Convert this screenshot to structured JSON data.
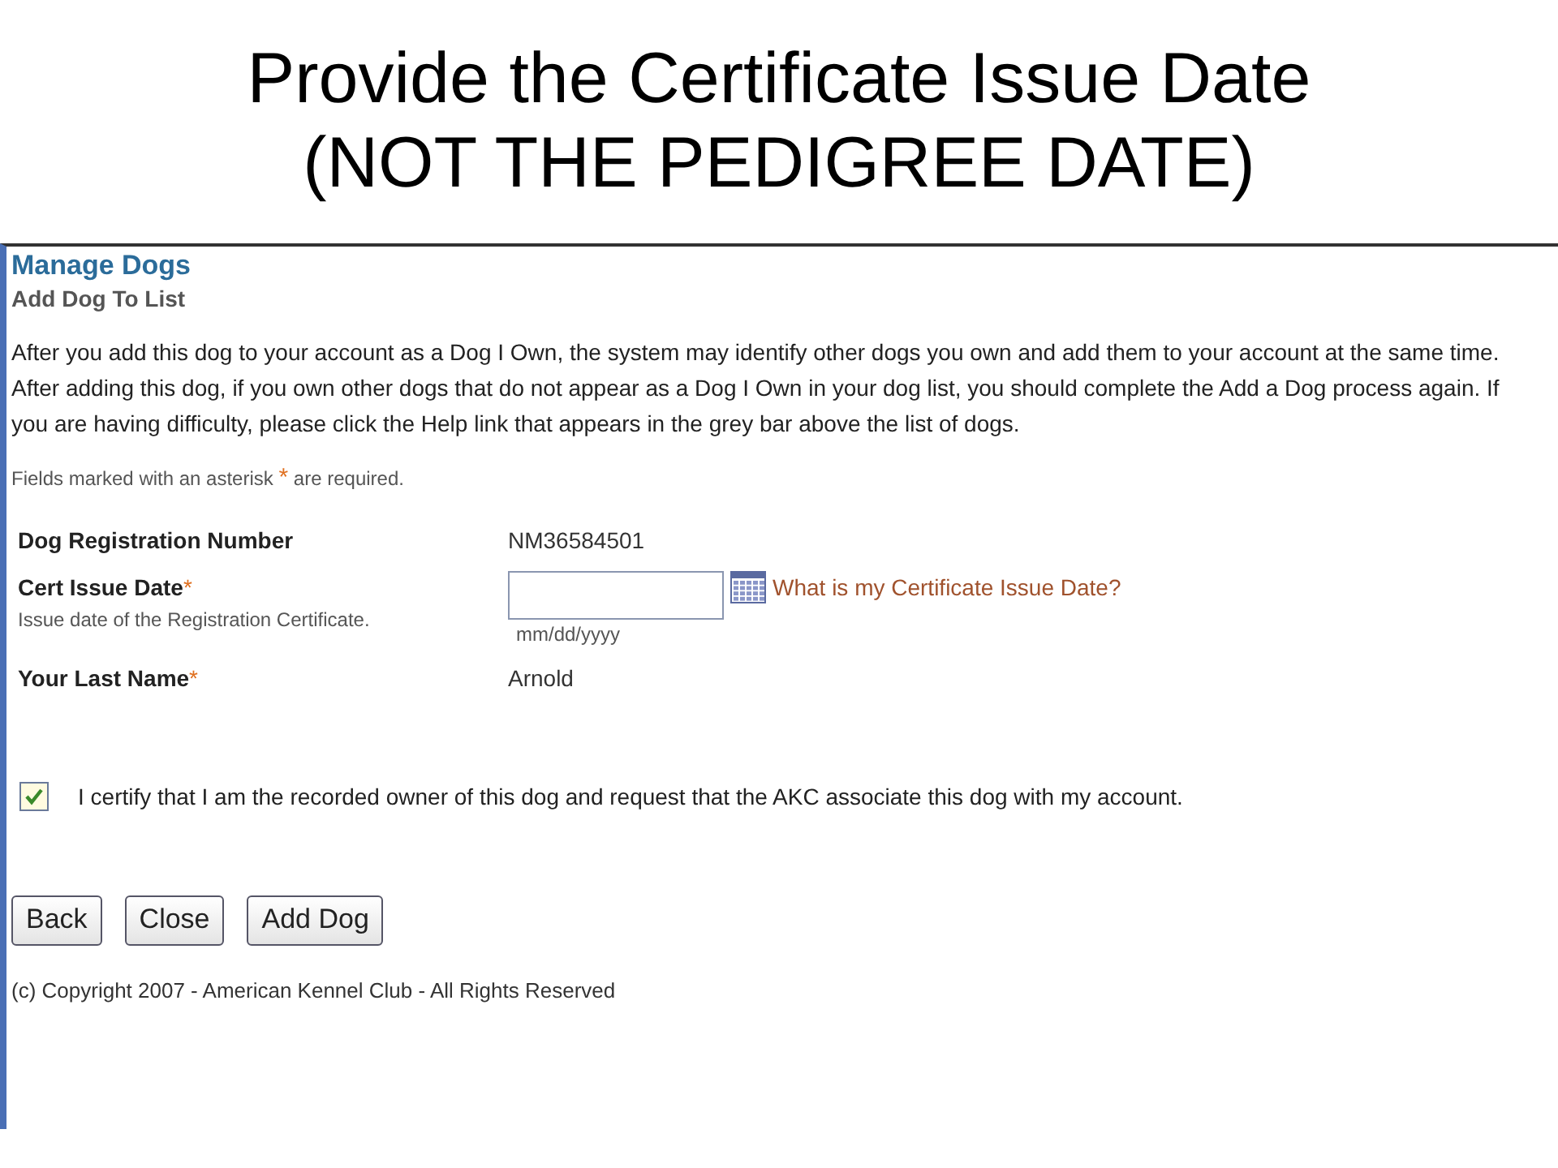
{
  "slide_title": [
    "Provide the Certificate Issue Date",
    "(NOT THE PEDIGREE DATE)"
  ],
  "page": {
    "title": "Manage Dogs",
    "subtitle": "Add Dog To List",
    "intro": "After you add this dog to your account as a Dog I Own, the system may identify other dogs you own and add them to your account at the same time. After adding this dog, if you own other dogs that do not appear as a Dog I Own in your dog list, you should complete the Add a Dog process again. If you are having difficulty, please click the Help link that appears in the grey bar above the list of dogs.",
    "required_note": {
      "before": "Fields marked with an asterisk",
      "mark": "*",
      "after": "are required."
    },
    "fields": [
      {
        "kind": "text",
        "label": "Dog Registration Number",
        "value": "NM36584501"
      },
      {
        "kind": "date",
        "label": "Cert Issue Date",
        "mark": "*",
        "hint": "Issue date of the Registration Certificate.",
        "format": "mm/dd/yyyy",
        "link": "What is my Certificate Issue Date?"
      },
      {
        "kind": "text",
        "label": "Your Last Name",
        "mark": "*",
        "value": "Arnold"
      }
    ],
    "certify": {
      "checked": true,
      "label": "I certify that I am the recorded owner of this dog and request that the AKC associate this dog with my account."
    },
    "buttons": [
      "Back",
      "Close",
      "Add Dog"
    ],
    "copyright": "(c) Copyright 2007 - American Kennel Club - All Rights Reserved"
  }
}
